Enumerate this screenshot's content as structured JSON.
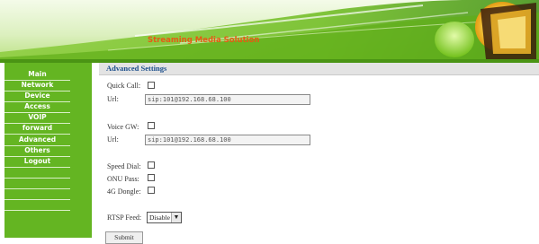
{
  "header": {
    "banner_title": "Streaming Media Solution"
  },
  "sidebar": {
    "items": [
      {
        "label": "Main"
      },
      {
        "label": "Network"
      },
      {
        "label": "Device"
      },
      {
        "label": "Access"
      },
      {
        "label": "VOIP"
      },
      {
        "label": "forward"
      },
      {
        "label": "Advanced"
      },
      {
        "label": "Others"
      },
      {
        "label": "Logout"
      }
    ]
  },
  "main": {
    "title": "Advanced Settings",
    "quick_call": {
      "label": "Quick Call:",
      "checked": false
    },
    "quick_call_url": {
      "label": "Url:",
      "value": "sip:101@192.168.68.100"
    },
    "voice_gw": {
      "label": "Voice GW:",
      "checked": false
    },
    "voice_gw_url": {
      "label": "Url:",
      "value": "sip:101@192.168.68.100"
    },
    "speed_dial": {
      "label": "Speed Dial:",
      "checked": false
    },
    "onu_pass": {
      "label": "ONU Pass:",
      "checked": false
    },
    "dongle_4g": {
      "label": "4G Dongle:",
      "checked": false
    },
    "rtsp_feed": {
      "label": "RTSP Feed:",
      "selected": "Disable"
    },
    "submit_label": "Submit"
  },
  "colors": {
    "sidebar": "#64b522",
    "title_text": "#1c4f8c",
    "banner_text": "#e65a14"
  }
}
